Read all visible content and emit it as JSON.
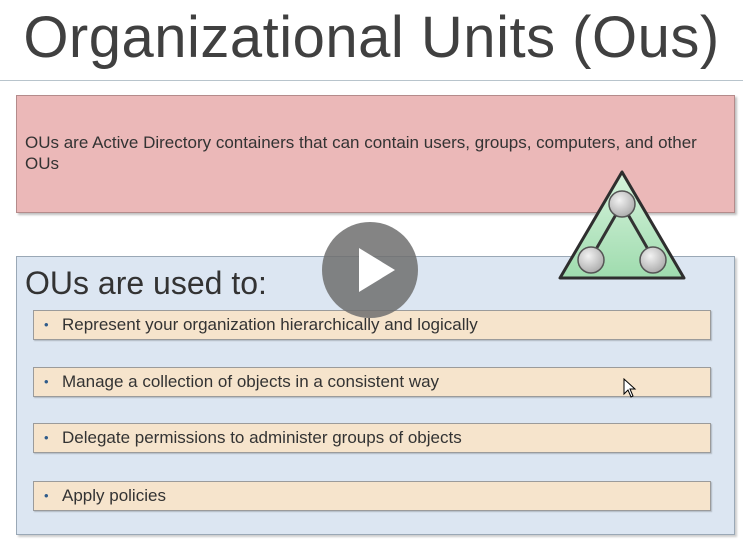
{
  "slide": {
    "title": "Organizational Units (Ous)",
    "definition": "OUs are Active Directory containers that can contain users, groups, computers, and other OUs",
    "uses_heading": "OUs are used to:",
    "uses": [
      {
        "bullet": "•",
        "label": "Represent your organization hierarchically and logically"
      },
      {
        "bullet": "•",
        "label": "Manage a collection of objects in a consistent way"
      },
      {
        "bullet": "•",
        "label": "Delegate permissions to administer groups of objects"
      },
      {
        "bullet": "•",
        "label": "Apply policies"
      }
    ]
  },
  "icons": {
    "hierarchy": "ou-hierarchy-triangle-icon",
    "play": "play-icon",
    "cursor": "mouse-pointer-icon"
  },
  "colors": {
    "definition_box": "#ebb8b8",
    "uses_box": "#dce6f2",
    "item_fill": "#f6e4cc",
    "triangle_fill": "#b9e6c4"
  }
}
